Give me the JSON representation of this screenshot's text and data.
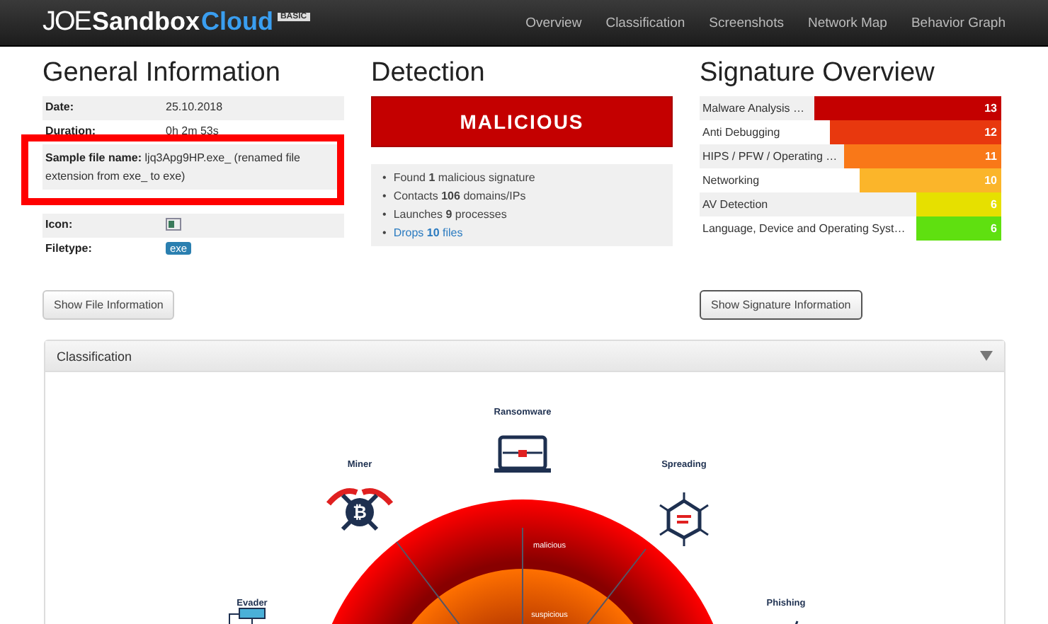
{
  "navbar": {
    "logo": {
      "prefix": "JOE",
      "name": "Sandbox",
      "product": "Cloud",
      "edition": "BASIC"
    },
    "links": [
      "Overview",
      "Classification",
      "Screenshots",
      "Network Map",
      "Behavior Graph"
    ]
  },
  "general_information": {
    "title": "General Information",
    "rows": [
      {
        "kind": "text",
        "label": "Date:",
        "value": "25.10.2018"
      },
      {
        "kind": "text",
        "label": "Duration:",
        "value": "0h 2m 53s"
      },
      {
        "kind": "text",
        "label": "Sample file name:",
        "value": "ljq3Apg9HP.exe_ (renamed file extension from exe_ to exe)",
        "highlighted": true
      },
      {
        "kind": "covered"
      },
      {
        "kind": "icon",
        "label": "Icon:"
      },
      {
        "kind": "badge",
        "label": "Filetype:",
        "value": "exe"
      }
    ],
    "button": "Show File Information"
  },
  "detection": {
    "title": "Detection",
    "verdict": "MALICIOUS",
    "bullet": "•",
    "items": [
      {
        "kind": "text",
        "text": "Found **1** malicious signature"
      },
      {
        "kind": "text",
        "text": "Contacts **106** domains/IPs"
      },
      {
        "kind": "text",
        "text": "Launches **9** processes"
      },
      {
        "kind": "link",
        "text": "Drops **10** files"
      }
    ]
  },
  "signature_overview": {
    "title": "Signature Overview",
    "rows": [
      {
        "name": "Malware Analysis …",
        "count": "13",
        "level": 0.62,
        "color": "#c40000"
      },
      {
        "name": "Anti Debugging",
        "count": "12",
        "level": 0.57,
        "color": "#e8380e"
      },
      {
        "name": "HIPS / PFW / Operating …",
        "count": "11",
        "level": 0.52,
        "color": "#f97818"
      },
      {
        "name": "Networking",
        "count": "10",
        "level": 0.47,
        "color": "#fbb52a"
      },
      {
        "name": "AV Detection",
        "count": "6",
        "level": 0.28,
        "color": "#e6e000"
      },
      {
        "name": "Language, Device and Operating Syst…",
        "count": "6",
        "level": 0.28,
        "color": "#5fe010"
      }
    ],
    "button": "Show Signature Information"
  },
  "classification": {
    "title": "Classification",
    "expanded": true,
    "rings": [
      "malicious",
      "suspicious"
    ],
    "categories": [
      {
        "kind": "ransomware",
        "label": "Ransomware"
      },
      {
        "kind": "miner",
        "label": "Miner",
        "glyph": "₿"
      },
      {
        "kind": "spreading",
        "label": "Spreading"
      },
      {
        "kind": "evader",
        "label": "Evader"
      },
      {
        "kind": "phishing",
        "label": "Phishing"
      }
    ]
  }
}
